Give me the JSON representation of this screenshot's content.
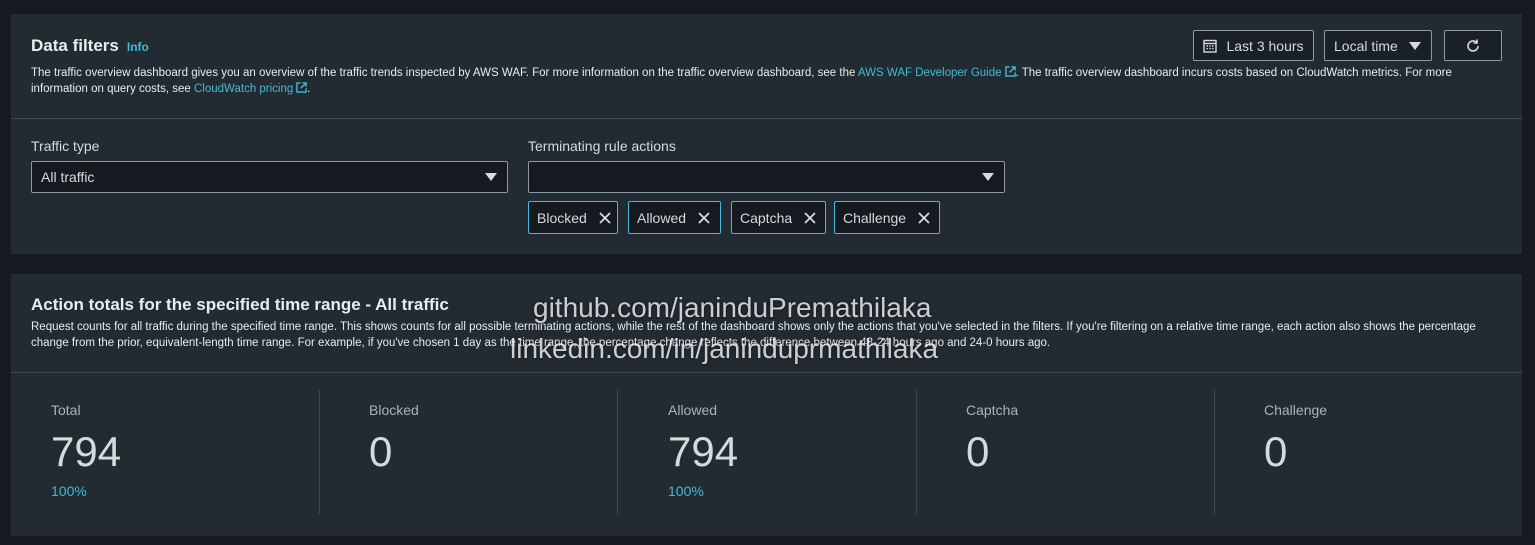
{
  "filters": {
    "title": "Data filters",
    "info": "Info",
    "desc_pre": "The traffic overview dashboard gives you an overview of the traffic trends inspected by AWS WAF. For more information on the traffic overview dashboard, see the ",
    "guide_link": "AWS WAF Developer Guide",
    "desc_mid": ". The traffic overview dashboard incurs costs based on CloudWatch metrics. For more information on query costs, see ",
    "pricing_link": "CloudWatch pricing",
    "desc_post": ".",
    "time_range": "Last 3 hours",
    "timezone": "Local time",
    "traffic_type_label": "Traffic type",
    "traffic_type_value": "All traffic",
    "rule_actions_label": "Terminating rule actions",
    "rule_actions_value": "",
    "tokens": [
      "Blocked",
      "Allowed",
      "Captcha",
      "Challenge"
    ]
  },
  "totals": {
    "title": "Action totals for the specified time range - All traffic",
    "desc": "Request counts for all traffic during the specified time range. This shows counts for all possible terminating actions, while the rest of the dashboard shows only the actions that you've selected in the filters. If you're filtering on a relative time range, each action also shows the percentage change from the prior, equivalent-length time range. For example, if you've chosen 1 day as the time range, the percentage change reflects the difference between 48-24 hours ago and 24-0 hours ago.",
    "stats": [
      {
        "label": "Total",
        "value": "794",
        "pct": "100%"
      },
      {
        "label": "Blocked",
        "value": "0",
        "pct": ""
      },
      {
        "label": "Allowed",
        "value": "794",
        "pct": "100%"
      },
      {
        "label": "Captcha",
        "value": "0",
        "pct": ""
      },
      {
        "label": "Challenge",
        "value": "0",
        "pct": ""
      }
    ]
  },
  "watermark": {
    "line1": "github.com/janinduPremathilaka",
    "line2": "linkedin.com/in/janinduprmathilaka"
  },
  "colors": {
    "accent": "#44b9d6",
    "panel": "#232b32",
    "background": "#16191f"
  },
  "icons": {
    "calendar": "calendar-icon",
    "refresh": "refresh-icon",
    "external": "external-link-icon",
    "dismiss": "close-icon"
  }
}
